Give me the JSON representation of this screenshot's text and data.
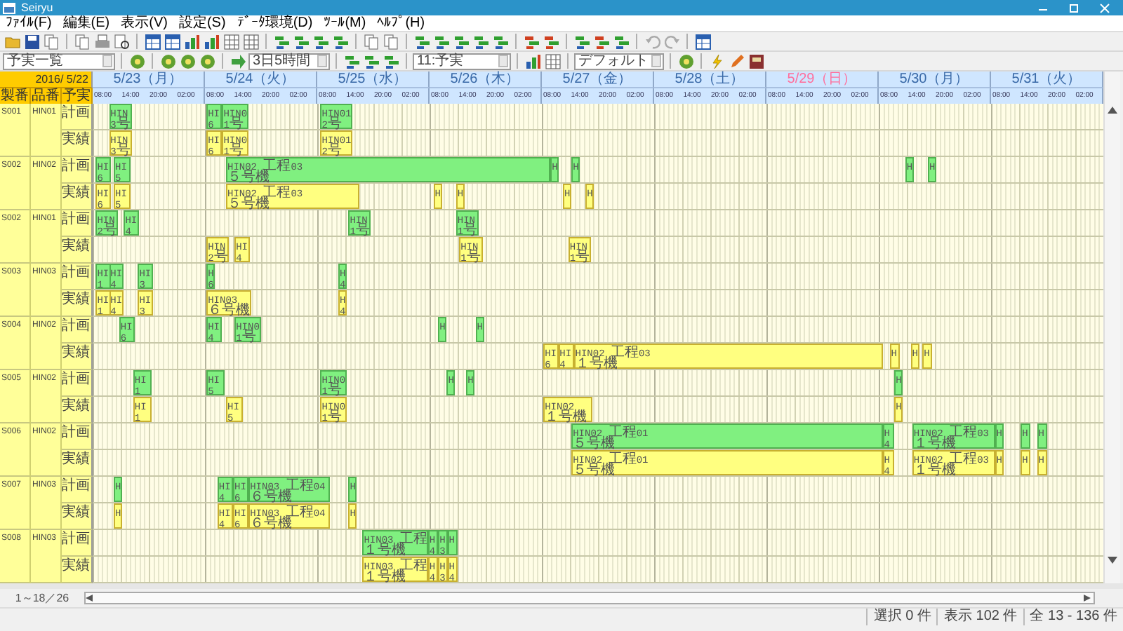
{
  "window": {
    "title": "Seiryu"
  },
  "menu": [
    "ﾌｧｲﾙ(F)",
    "編集(E)",
    "表示(V)",
    "設定(S)",
    "ﾃﾞｰﾀ環境(D)",
    "ﾂｰﾙ(M)",
    "ﾍﾙﾌﾟ(H)"
  ],
  "toolbar_fields": [
    {
      "value": "予実一覧"
    },
    {
      "value": "3日5時間"
    },
    {
      "value": "11:予実"
    },
    {
      "value": "デフォルト"
    }
  ],
  "header": {
    "base_date": "2016/ 5/22",
    "columns": [
      "製番",
      "品番",
      "予実"
    ],
    "days": [
      {
        "label": "5/23（月）",
        "holiday": false,
        "hours": [
          "08:00",
          "14:00",
          "20:00",
          "02:00"
        ]
      },
      {
        "label": "5/24（火）",
        "holiday": false,
        "hours": [
          "08:00",
          "14:00",
          "20:00",
          "02:00"
        ]
      },
      {
        "label": "5/25（水）",
        "holiday": false,
        "hours": [
          "08:00",
          "14:00",
          "20:00",
          "02:00"
        ]
      },
      {
        "label": "5/26（木）",
        "holiday": false,
        "hours": [
          "08:00",
          "14:00",
          "20:00",
          "02:00"
        ]
      },
      {
        "label": "5/27（金）",
        "holiday": false,
        "hours": [
          "08:00",
          "14:00",
          "20:00",
          "02:00"
        ]
      },
      {
        "label": "5/28（土）",
        "holiday": false,
        "hours": [
          "08:00",
          "14:00",
          "20:00",
          "02:00"
        ]
      },
      {
        "label": "5/29（日）",
        "holiday": true,
        "hours": [
          "08:00",
          "14:00",
          "20:00",
          "02:00"
        ]
      },
      {
        "label": "5/30（月）",
        "holiday": false,
        "hours": [
          "08:00",
          "14:00",
          "20:00",
          "02:00"
        ]
      },
      {
        "label": "5/31（火）",
        "holiday": false,
        "hours": [
          "08:00",
          "14:00",
          "20:00",
          "02:00"
        ]
      }
    ]
  },
  "orders": [
    {
      "order": "S001",
      "part": "HIN01",
      "rows": [
        {
          "label": "計画",
          "kind": "plan",
          "bars": [
            {
              "lines": [
                "HIN",
                "3号"
              ]
            },
            {
              "lines": [
                "HI",
                "6"
              ]
            },
            {
              "lines": [
                "HIN0",
                "1号"
              ]
            },
            {
              "lines": [
                "HIN01",
                "2号"
              ]
            }
          ]
        },
        {
          "label": "実績",
          "kind": "actual",
          "bars": [
            {
              "lines": [
                "HIN",
                "3号"
              ]
            },
            {
              "lines": [
                "HI",
                "6"
              ]
            },
            {
              "lines": [
                "HIN0",
                "1号"
              ]
            },
            {
              "lines": [
                "HIN01",
                "2号"
              ]
            }
          ]
        }
      ]
    },
    {
      "order": "S002",
      "part": "HIN02",
      "rows": [
        {
          "label": "計画",
          "kind": "plan",
          "bars": [
            {
              "lines": [
                "HI",
                "6"
              ]
            },
            {
              "lines": [
                "HI",
                "5"
              ]
            },
            {
              "lines": [
                "HIN02 工程03",
                "５号機"
              ]
            },
            {
              "lines": [
                "H"
              ]
            },
            {
              "lines": [
                "H"
              ]
            },
            {
              "lines": [
                "H"
              ]
            },
            {
              "lines": [
                "H"
              ]
            }
          ]
        },
        {
          "label": "実績",
          "kind": "actual",
          "bars": [
            {
              "lines": [
                "HI",
                "6"
              ]
            },
            {
              "lines": [
                "HI",
                "5"
              ]
            },
            {
              "lines": [
                "HIN02 工程03",
                "５号機"
              ]
            },
            {
              "lines": [
                "H"
              ]
            },
            {
              "lines": [
                "H"
              ]
            },
            {
              "lines": [
                "H"
              ]
            },
            {
              "lines": [
                "H"
              ]
            }
          ]
        }
      ]
    },
    {
      "order": "S002",
      "part": "HIN01",
      "rows": [
        {
          "label": "計画",
          "kind": "plan",
          "bars": [
            {
              "lines": [
                "HIN",
                "2号"
              ]
            },
            {
              "lines": [
                "HI",
                "4"
              ]
            },
            {
              "lines": [
                "HIN",
                "1号"
              ]
            },
            {
              "lines": [
                "HIN",
                "1号"
              ]
            }
          ]
        },
        {
          "label": "実績",
          "kind": "actual",
          "bars": [
            {
              "lines": [
                "HIN",
                "2号"
              ]
            },
            {
              "lines": [
                "HI",
                "4"
              ]
            },
            {
              "lines": [
                "HIN",
                "1号"
              ]
            },
            {
              "lines": [
                "HIN",
                "1号"
              ]
            }
          ]
        }
      ]
    },
    {
      "order": "S003",
      "part": "HIN03",
      "rows": [
        {
          "label": "計画",
          "kind": "plan",
          "bars": [
            {
              "lines": [
                "HI",
                "1"
              ]
            },
            {
              "lines": [
                "HI",
                "4"
              ]
            },
            {
              "lines": [
                "HI",
                "3"
              ]
            },
            {
              "lines": [
                "H",
                "6"
              ]
            },
            {
              "lines": [
                "H",
                "4"
              ]
            }
          ]
        },
        {
          "label": "実績",
          "kind": "actual",
          "bars": [
            {
              "lines": [
                "HI",
                "1"
              ]
            },
            {
              "lines": [
                "HI",
                "4"
              ]
            },
            {
              "lines": [
                "HI",
                "3"
              ]
            },
            {
              "lines": [
                "HIN03",
                "６号機"
              ]
            },
            {
              "lines": [
                "H",
                "4"
              ]
            }
          ]
        }
      ]
    },
    {
      "order": "S004",
      "part": "HIN02",
      "rows": [
        {
          "label": "計画",
          "kind": "plan",
          "bars": [
            {
              "lines": [
                "HI",
                "6"
              ]
            },
            {
              "lines": [
                "HI",
                "4"
              ]
            },
            {
              "lines": [
                "HIN0",
                "1号"
              ]
            },
            {
              "lines": [
                "H"
              ]
            },
            {
              "lines": [
                "H"
              ]
            }
          ]
        },
        {
          "label": "実績",
          "kind": "actual",
          "bars": [
            {
              "lines": [
                "HI",
                "6"
              ]
            },
            {
              "lines": [
                "HI",
                "4"
              ]
            },
            {
              "lines": [
                "HIN02 工程03",
                "１号機"
              ]
            },
            {
              "lines": [
                "H"
              ]
            },
            {
              "lines": [
                "H"
              ]
            },
            {
              "lines": [
                "H"
              ]
            }
          ]
        }
      ]
    },
    {
      "order": "S005",
      "part": "HIN02",
      "rows": [
        {
          "label": "計画",
          "kind": "plan",
          "bars": [
            {
              "lines": [
                "HI",
                "1"
              ]
            },
            {
              "lines": [
                "HI",
                "5"
              ]
            },
            {
              "lines": [
                "HIN0",
                "1号"
              ]
            },
            {
              "lines": [
                "H"
              ]
            },
            {
              "lines": [
                "H"
              ]
            },
            {
              "lines": [
                "H"
              ]
            }
          ]
        },
        {
          "label": "実績",
          "kind": "actual",
          "bars": [
            {
              "lines": [
                "HI",
                "1"
              ]
            },
            {
              "lines": [
                "HI",
                "5"
              ]
            },
            {
              "lines": [
                "HIN0",
                "1号"
              ]
            },
            {
              "lines": [
                "HIN02",
                "１号機"
              ]
            },
            {
              "lines": [
                "H"
              ]
            }
          ]
        }
      ]
    },
    {
      "order": "S006",
      "part": "HIN02",
      "rows": [
        {
          "label": "計画",
          "kind": "plan",
          "bars": [
            {
              "lines": [
                "HIN02 工程01",
                "５号機"
              ]
            },
            {
              "lines": [
                "H",
                "4"
              ]
            },
            {
              "lines": [
                "HIN02 工程03",
                "１号機"
              ]
            },
            {
              "lines": [
                "H"
              ]
            },
            {
              "lines": [
                "H"
              ]
            },
            {
              "lines": [
                "H"
              ]
            }
          ]
        },
        {
          "label": "実績",
          "kind": "actual",
          "bars": [
            {
              "lines": [
                "HIN02 工程01",
                "５号機"
              ]
            },
            {
              "lines": [
                "H",
                "4"
              ]
            },
            {
              "lines": [
                "HIN02 工程03",
                "１号機"
              ]
            },
            {
              "lines": [
                "H"
              ]
            },
            {
              "lines": [
                "H"
              ]
            },
            {
              "lines": [
                "H"
              ]
            }
          ]
        }
      ]
    },
    {
      "order": "S007",
      "part": "HIN03",
      "rows": [
        {
          "label": "計画",
          "kind": "plan",
          "bars": [
            {
              "lines": [
                "H"
              ]
            },
            {
              "lines": [
                "HI",
                "4"
              ]
            },
            {
              "lines": [
                "HI",
                "6"
              ]
            },
            {
              "lines": [
                "HIN03 工程04",
                "６号機"
              ]
            },
            {
              "lines": [
                "H"
              ]
            }
          ]
        },
        {
          "label": "実績",
          "kind": "actual",
          "bars": [
            {
              "lines": [
                "H"
              ]
            },
            {
              "lines": [
                "HI",
                "4"
              ]
            },
            {
              "lines": [
                "HI",
                "6"
              ]
            },
            {
              "lines": [
                "HIN03 工程04",
                "６号機"
              ]
            },
            {
              "lines": [
                "H"
              ]
            }
          ]
        }
      ]
    },
    {
      "order": "S008",
      "part": "HIN03",
      "rows": [
        {
          "label": "計画",
          "kind": "plan",
          "bars": [
            {
              "lines": [
                "HIN03 工程",
                "１号機"
              ]
            },
            {
              "lines": [
                "H",
                "4"
              ]
            },
            {
              "lines": [
                "H",
                "3"
              ]
            },
            {
              "lines": [
                "H"
              ]
            }
          ]
        },
        {
          "label": "実績",
          "kind": "actual",
          "bars": [
            {
              "lines": [
                "HIN03 工程",
                "１号機"
              ]
            },
            {
              "lines": [
                "H",
                "4"
              ]
            },
            {
              "lines": [
                "H",
                "3"
              ]
            },
            {
              "lines": [
                "H",
                "4"
              ]
            }
          ]
        }
      ]
    }
  ],
  "row_range": "1～18／26",
  "status": [
    "選択 0 件",
    "表示 102 件",
    "全 13 - 136 件"
  ]
}
